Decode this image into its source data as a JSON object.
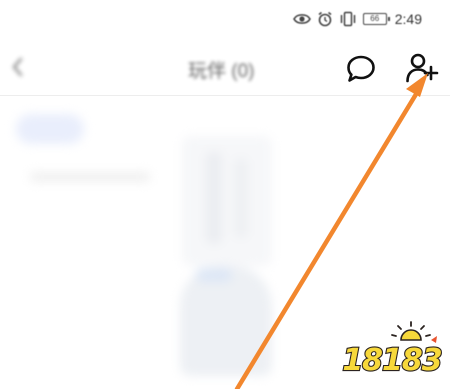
{
  "status_bar": {
    "carrier": "",
    "battery_level": "66",
    "time": "2:49",
    "icons": [
      "eye-icon",
      "alarm-icon",
      "vibrate-icon",
      "battery-icon"
    ]
  },
  "header": {
    "title": "玩伴 (0)",
    "back_icon": "chevron-left-icon",
    "chat_icon": "chat-bubble-icon",
    "add_friend_icon": "add-user-icon"
  },
  "content": {
    "tabs": [
      {
        "label": "",
        "active": true
      },
      {
        "label": "",
        "active": false
      }
    ]
  },
  "annotation": {
    "arrow_color": "#F2872E",
    "points_to": "add-friend-button"
  },
  "watermark": {
    "text": "18183",
    "colors": {
      "fill": "#F7D83A",
      "outline": "#2B2320"
    }
  },
  "colors": {
    "background": "#FFFFFF",
    "accent_blue": "#4F73E8",
    "arrow_orange": "#F2872E"
  }
}
